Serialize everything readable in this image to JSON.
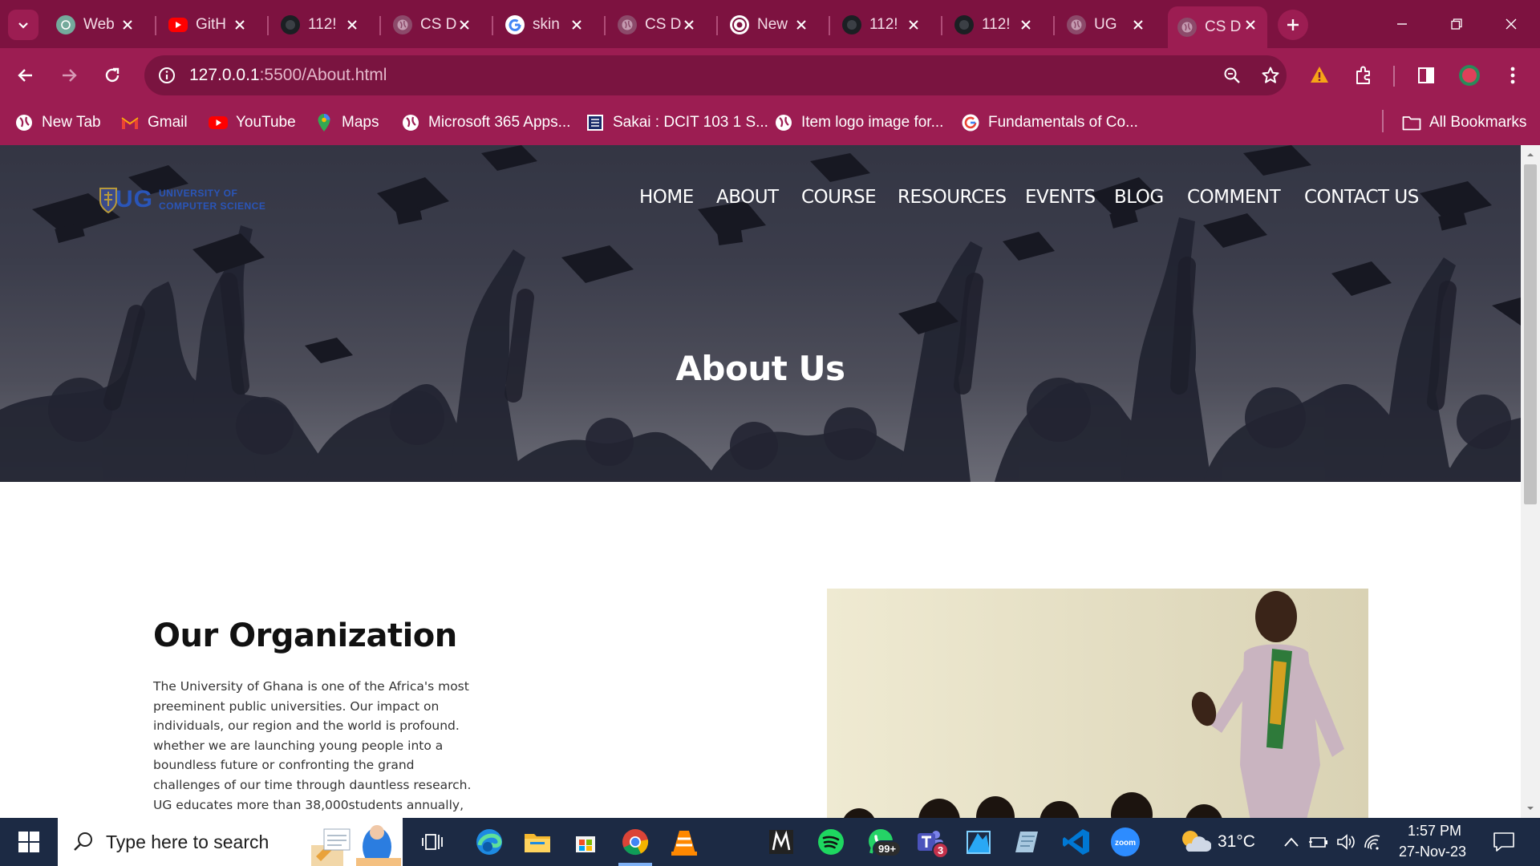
{
  "browser": {
    "tabs": [
      {
        "title": "Web",
        "favicon": "chatgpt-icon"
      },
      {
        "title": "GitH",
        "favicon": "youtube-icon"
      },
      {
        "title": "112!",
        "favicon": "github-icon"
      },
      {
        "title": "CS D",
        "favicon": "globe-icon"
      },
      {
        "title": "skin",
        "favicon": "google-icon"
      },
      {
        "title": "CS D",
        "favicon": "globe-icon"
      },
      {
        "title": "New",
        "favicon": "chrome-icon"
      },
      {
        "title": "112!",
        "favicon": "github-icon"
      },
      {
        "title": "112!",
        "favicon": "github-icon"
      },
      {
        "title": "UG",
        "favicon": "globe-icon"
      },
      {
        "title": "CS D",
        "favicon": "globe-icon",
        "active": true
      }
    ],
    "url_host": "127.0.0.1",
    "url_path": ":5500/About.html",
    "bookmarks": [
      {
        "label": "New Tab",
        "icon": "globe-icon"
      },
      {
        "label": "Gmail",
        "icon": "gmail-icon"
      },
      {
        "label": "YouTube",
        "icon": "youtube-icon"
      },
      {
        "label": "Maps",
        "icon": "maps-pin-icon"
      },
      {
        "label": "Microsoft 365 Apps...",
        "icon": "globe-icon"
      },
      {
        "label": "Sakai : DCIT 103 1 S...",
        "icon": "sakai-icon"
      },
      {
        "label": "Item logo image for...",
        "icon": "globe-icon"
      },
      {
        "label": "Fundamentals of Co...",
        "icon": "google-icon"
      }
    ],
    "all_bookmarks": "All Bookmarks"
  },
  "site": {
    "logo_text": "UG",
    "logo_line1": "UNIVERSITY OF",
    "logo_line2": "COMPUTER SCIENCE",
    "nav": [
      "HOME",
      "ABOUT",
      "COURSE",
      "RESOURCES",
      "EVENTS",
      "BLOG",
      "COMMENT",
      "CONTACT US"
    ],
    "hero_title": "About Us",
    "section_heading": "Our Organization",
    "section_lines": [
      "The University of Ghana is one of the Africa's most",
      "preeminent public universities. Our impact on",
      "individuals, our region and the world is profound.",
      "whether we are launching young people into a",
      "boundless future or confronting the grand",
      "challenges of our time through dauntless research.",
      "UG educates more than 38,000students annually,"
    ]
  },
  "taskbar": {
    "search_placeholder": "Type here to search",
    "apps": [
      "task-view-icon",
      "edge-icon",
      "file-explorer-icon",
      "microsoft-store-icon",
      "chrome-icon",
      "vlc-icon",
      "mendeley-icon",
      "spotify-icon",
      "whatsapp-icon",
      "teams-icon",
      "paint-icon",
      "notepad-icon",
      "vscode-icon",
      "zoom-icon"
    ],
    "whatsapp_badge": "99+",
    "teams_badge": "3",
    "weather": "31°C",
    "time": "1:57 PM",
    "date": "27-Nov-23"
  },
  "colors": {
    "chrome_bar": "#9c1d52",
    "tab_strip": "#7d1240",
    "omnibox": "#7a1440",
    "taskbar": "#1c2a44",
    "logo_blue": "#2a55b8"
  }
}
